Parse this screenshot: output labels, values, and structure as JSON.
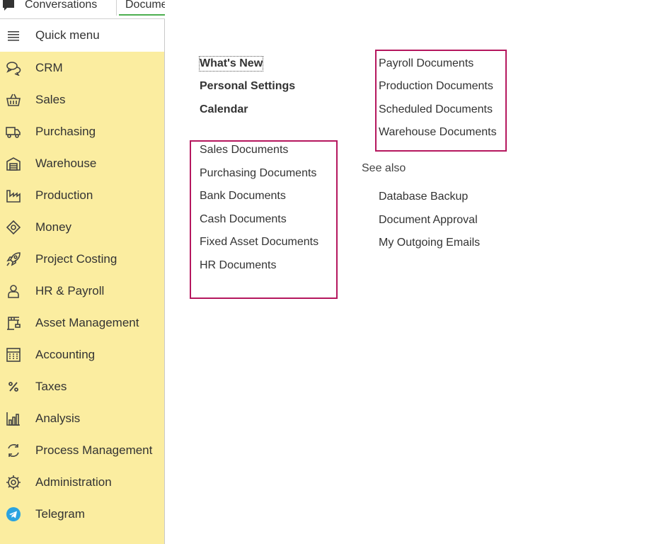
{
  "tabs": {
    "conversations": "Conversations",
    "documents": "Docume"
  },
  "sidebar": {
    "quick_menu": "Quick menu",
    "items": [
      {
        "label": "CRM",
        "icon": "chat-bubbles-icon"
      },
      {
        "label": "Sales",
        "icon": "basket-icon"
      },
      {
        "label": "Purchasing",
        "icon": "truck-icon"
      },
      {
        "label": "Warehouse",
        "icon": "warehouse-icon"
      },
      {
        "label": "Production",
        "icon": "factory-icon"
      },
      {
        "label": "Money",
        "icon": "money-tag-icon"
      },
      {
        "label": "Project Costing",
        "icon": "rocket-icon"
      },
      {
        "label": "HR & Payroll",
        "icon": "person-icon"
      },
      {
        "label": "Asset Management",
        "icon": "crane-icon"
      },
      {
        "label": "Accounting",
        "icon": "calculator-icon"
      },
      {
        "label": "Taxes",
        "icon": "percent-icon"
      },
      {
        "label": "Analysis",
        "icon": "bar-chart-icon"
      },
      {
        "label": "Process Management",
        "icon": "cycle-arrows-icon"
      },
      {
        "label": "Administration",
        "icon": "gear-icon"
      },
      {
        "label": "Telegram",
        "icon": "telegram-icon"
      }
    ]
  },
  "content": {
    "top_links": [
      "What's New",
      "Personal Settings",
      "Calendar"
    ],
    "left_docs": [
      "Sales Documents",
      "Purchasing Documents",
      "Bank Documents",
      "Cash Documents",
      "Fixed Asset Documents",
      "HR Documents"
    ],
    "right_docs": [
      "Payroll Documents",
      "Production Documents",
      "Scheduled Documents",
      "Warehouse Documents"
    ],
    "see_also_title": "See also",
    "see_also_links": [
      "Database Backup",
      "Document Approval",
      "My Outgoing Emails"
    ]
  },
  "colors": {
    "sidebar_bg": "#fbeda0",
    "highlight_border": "#b5175e",
    "active_tab_underline": "#4caf50",
    "telegram_blue": "#2aa3e0"
  }
}
